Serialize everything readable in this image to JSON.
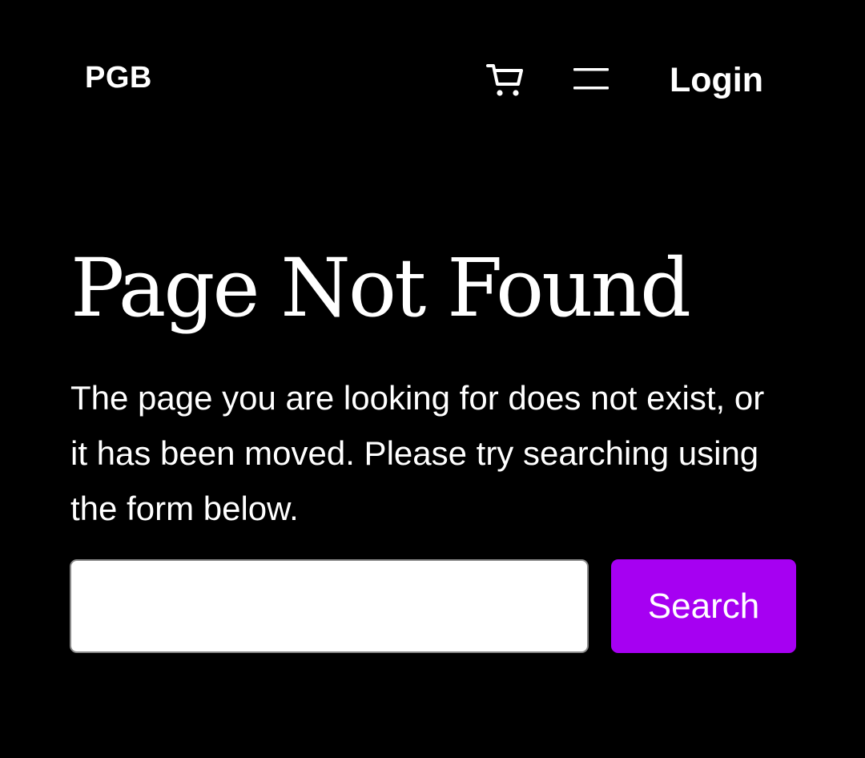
{
  "header": {
    "logo": "PGB",
    "cart_icon": "cart-icon",
    "menu_icon": "hamburger-menu-icon",
    "login_label": "Login"
  },
  "main": {
    "title": "Page Not Found",
    "description": "The page you are looking for does not exist, or it has been moved. Please try searching using the form below.",
    "search": {
      "value": "",
      "placeholder": "",
      "button_label": "Search"
    }
  },
  "colors": {
    "background": "#000000",
    "text": "#ffffff",
    "accent": "#a600f2"
  }
}
